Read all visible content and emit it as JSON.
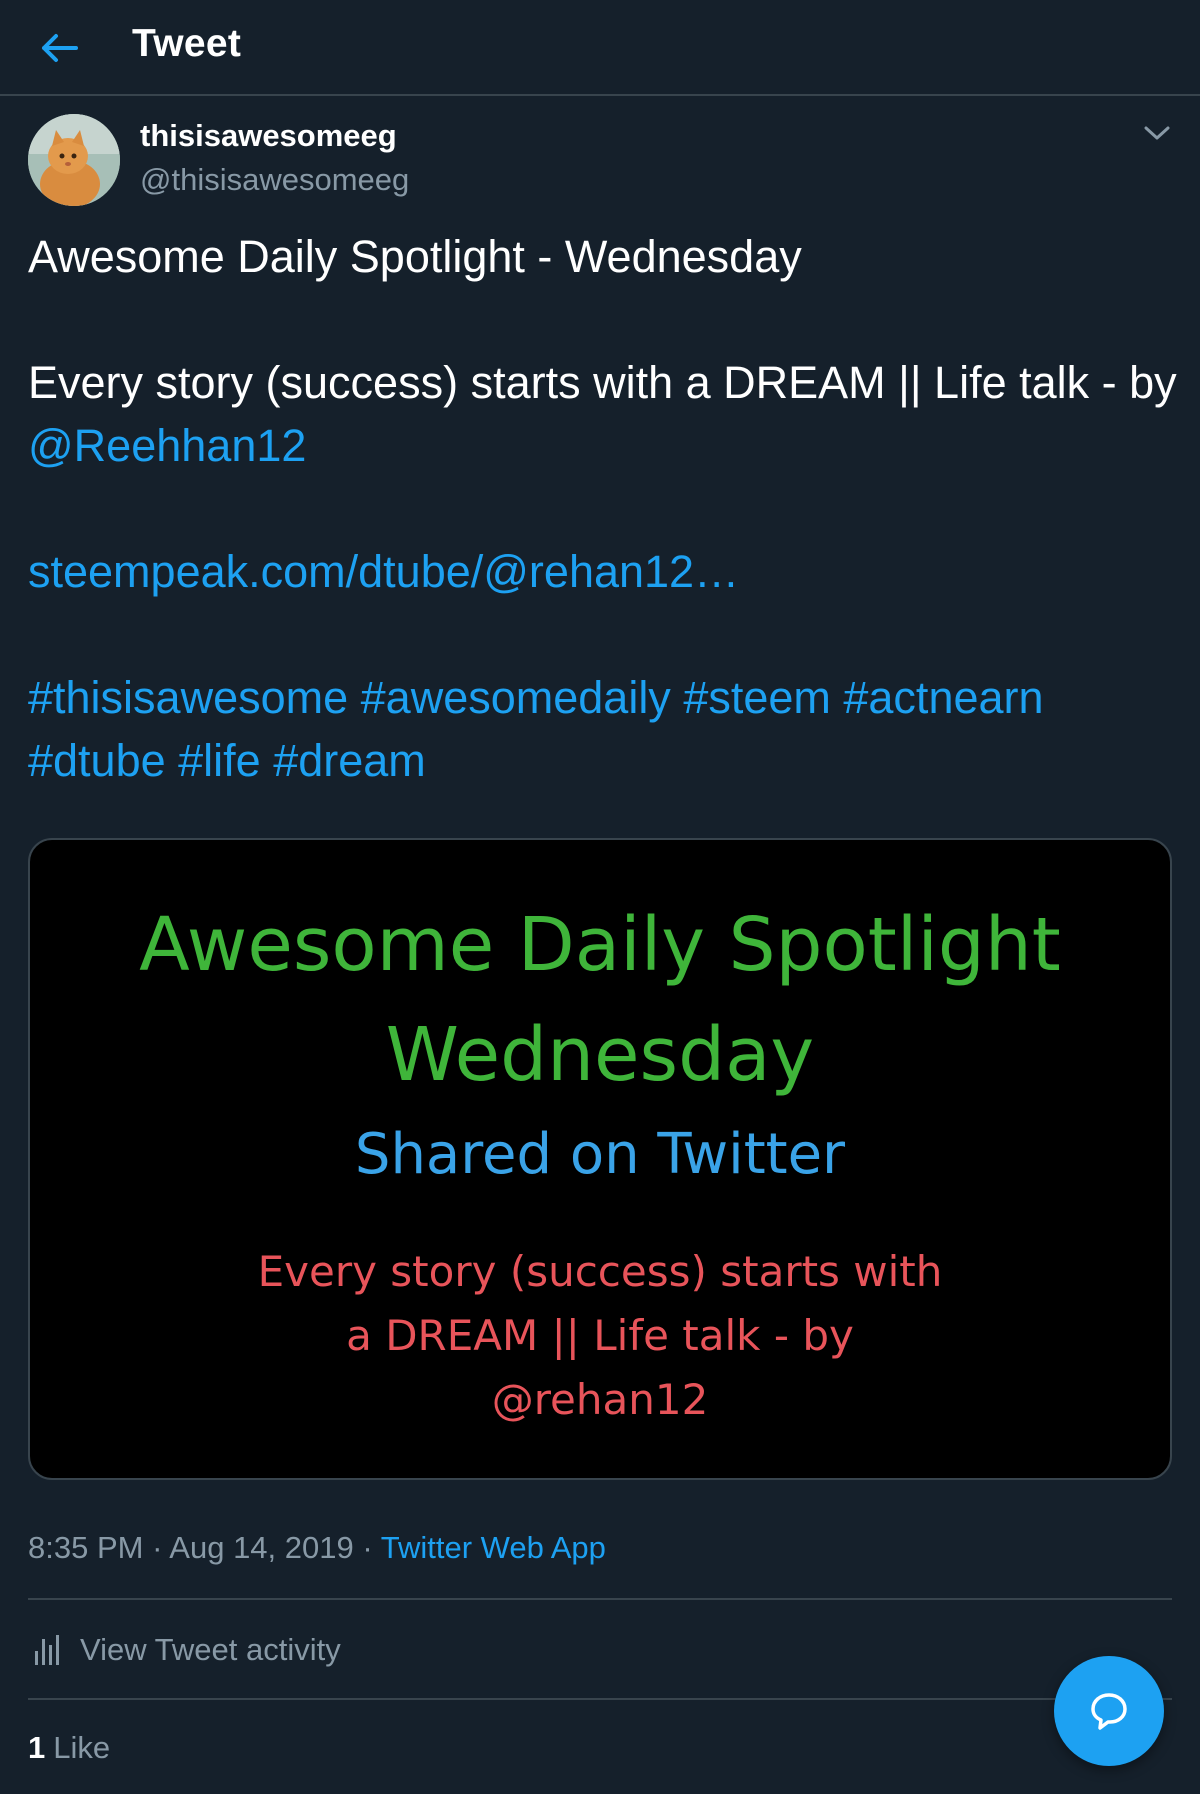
{
  "header": {
    "title": "Tweet"
  },
  "tweet": {
    "display_name": "thisisawesomeeg",
    "handle": "@thisisawesomeeg",
    "line1": "Awesome Daily Spotlight - Wednesday",
    "line2": "Every story (success) starts with a DREAM || Life talk - by ",
    "mention": "@Reehhan12",
    "url": "steempeak.com/dtube/@rehan12…",
    "hashtags": "#thisisawesome #awesomedaily #steem #actnearn #dtube #life #dream"
  },
  "media": {
    "title1": "Awesome Daily Spotlight",
    "title2": "Wednesday",
    "subtitle": "Shared on Twitter",
    "caption_line1": "Every story (success) starts with",
    "caption_line2": "a DREAM || Life talk - by",
    "caption_line3": "@rehan12"
  },
  "meta": {
    "time": "8:35 PM",
    "separator": " · ",
    "date": "Aug 14, 2019",
    "source": "Twitter Web App"
  },
  "activity": {
    "label": "View Tweet activity"
  },
  "likes": {
    "count": "1",
    "label": "Like"
  },
  "colors": {
    "background": "#15202b",
    "accent": "#1da1f2",
    "secondary_text": "#8899a6",
    "border": "#38444d"
  },
  "icons": {
    "back": "arrow-left-icon",
    "caret": "chevron-down-icon",
    "activity": "bar-chart-icon",
    "reply": "speech-bubble-icon"
  }
}
